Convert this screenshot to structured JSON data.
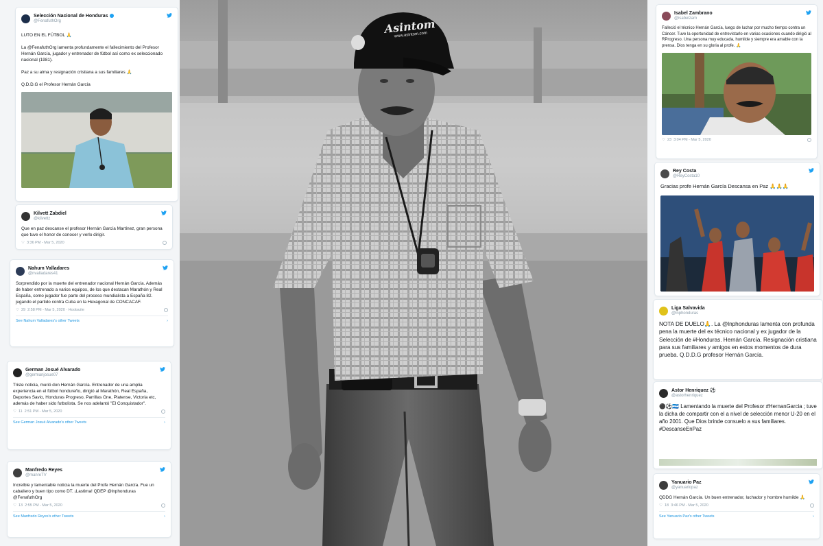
{
  "left": [
    {
      "name": "Selección Nacional de Honduras",
      "handle": "@FenafuthOrg",
      "lines": [
        "LUTO EN EL FÚTBOL 🙏",
        "",
        "La @FenafuthOrg lamenta profundamente el fallecimiento del Profesor Hernán García, jugador y entrenador de fútbol así como ex seleccionado nacional (1981).",
        "",
        "Paz a su alma y resignación cristiana a sus familiares 🙏",
        "",
        "Q.D.D.G el Profesor Hernán García"
      ]
    },
    {
      "name": "Kilvett Zabdiel",
      "handle": "@kilvettz",
      "text": "Que en paz descanse el profesor Hernán García Martínez, gran persona que tuve el honor de conocer y verlo dirigir.",
      "meta": "3:36 PM - Mar 5, 2020"
    },
    {
      "name": "Nahum Valladares",
      "handle": "@nvalladares41",
      "text": "Sorprendido por la muerte del entrenador nacional Hernán García. Además de haber entrenado a varios equipos, de los que destacan Marathón y Real España, como jugador fue parte del proceso mundialista a España 82. jugando el partido contra Cuba en la Hexagonal de CONCACAF.",
      "meta": "2:58 PM - Mar 5, 2020 · Hootsuite",
      "likes": "29",
      "footer": "See Nahum Valladares's other Tweets"
    },
    {
      "name": "German Josué Alvarado",
      "handle": "@germanjosue07",
      "text": "Triste noticia, murió don Hernán García. Entrenador de una amplia experiencia en el fútbol hondureño, dirigió al Marathón, Real España, Deportes Savio, Honduras Progreso, Parrillas One, Platense, Victoria etc, además de haber sido futbolista. Se nos adelantó \"El Conquistador\".",
      "meta": "2:51 PM - Mar 5, 2020",
      "likes": "11",
      "footer": "See German Josué Alvarado's other Tweets"
    },
    {
      "name": "Manfredo Reyes",
      "handle": "@manreTV",
      "text": "Increíble y lamentable noticia la muerte del Profe Hernán García. Fue un caballero y buen tipo como DT. ¡Lastima! QDEP @lnphonduras @FenafuthOrg",
      "meta": "2:55 PM - Mar 5, 2020",
      "likes": "13",
      "footer": "See Manfredo Reyes's other Tweets"
    }
  ],
  "right": [
    {
      "name": "Isabel Zambrano",
      "handle": "@isabelzam",
      "text": "Falleció el técnico Hernán García, luego de luchar por mucho tiempo contra un Cáncer. Tuve la oportunidad de entrevistarlo en varias ocasiones cuando dirigió al RProgreso. Una persona muy educada, humilde y siempre era amable con la prensa. Dios tenga en su gloria al profe. 🙏",
      "meta": "3:04 PM - Mar 5, 2020",
      "likes": "23"
    },
    {
      "name": "Rey Costa",
      "handle": "@ReyCosta10",
      "text": "Gracias profe Hernán García Descansa en Paz 🙏🙏🙏"
    },
    {
      "name": "Liga Salvavida",
      "handle": "@lnphonduras",
      "text": "NOTA DE DUELO🙏. La @lnphonduras lamenta con profunda pena la muerte del ex técnico nacional y ex jugador de la Selección de #Honduras. Hernán García. Resignación cristiana para sus familiares y amigos en estos momentos de dura prueba. Q.D.D.G profesor Hernán García."
    },
    {
      "name": "Astor Henriquez ⚽",
      "handle": "@astorhenriquez",
      "text": "⚫⚽🇭🇳 Lamentando la muerte del Profesor #HernanGarcia ; tuve la dicha de compartir con el a nivel de selección menor U-20 en el año 2001. Que Dios brinde consuelo a sus familiares. #DescanseEnPaz"
    },
    {
      "name": "Yanuario Paz",
      "handle": "@yanuariopaz",
      "text": "QDDG Hernán García. Un buen entrenador, luchador y hombre humilde 🙏",
      "meta": "3:46 PM - Mar 5, 2020",
      "likes": "18",
      "footer": "See Yanuario Paz's other Tweets"
    }
  ],
  "cap": {
    "line1": "Asintom",
    "line2": "www.asintom.com"
  },
  "colors": {
    "twitter_blue": "#1da1f2",
    "link": "#1b95e0",
    "muted": "#8899a6"
  }
}
